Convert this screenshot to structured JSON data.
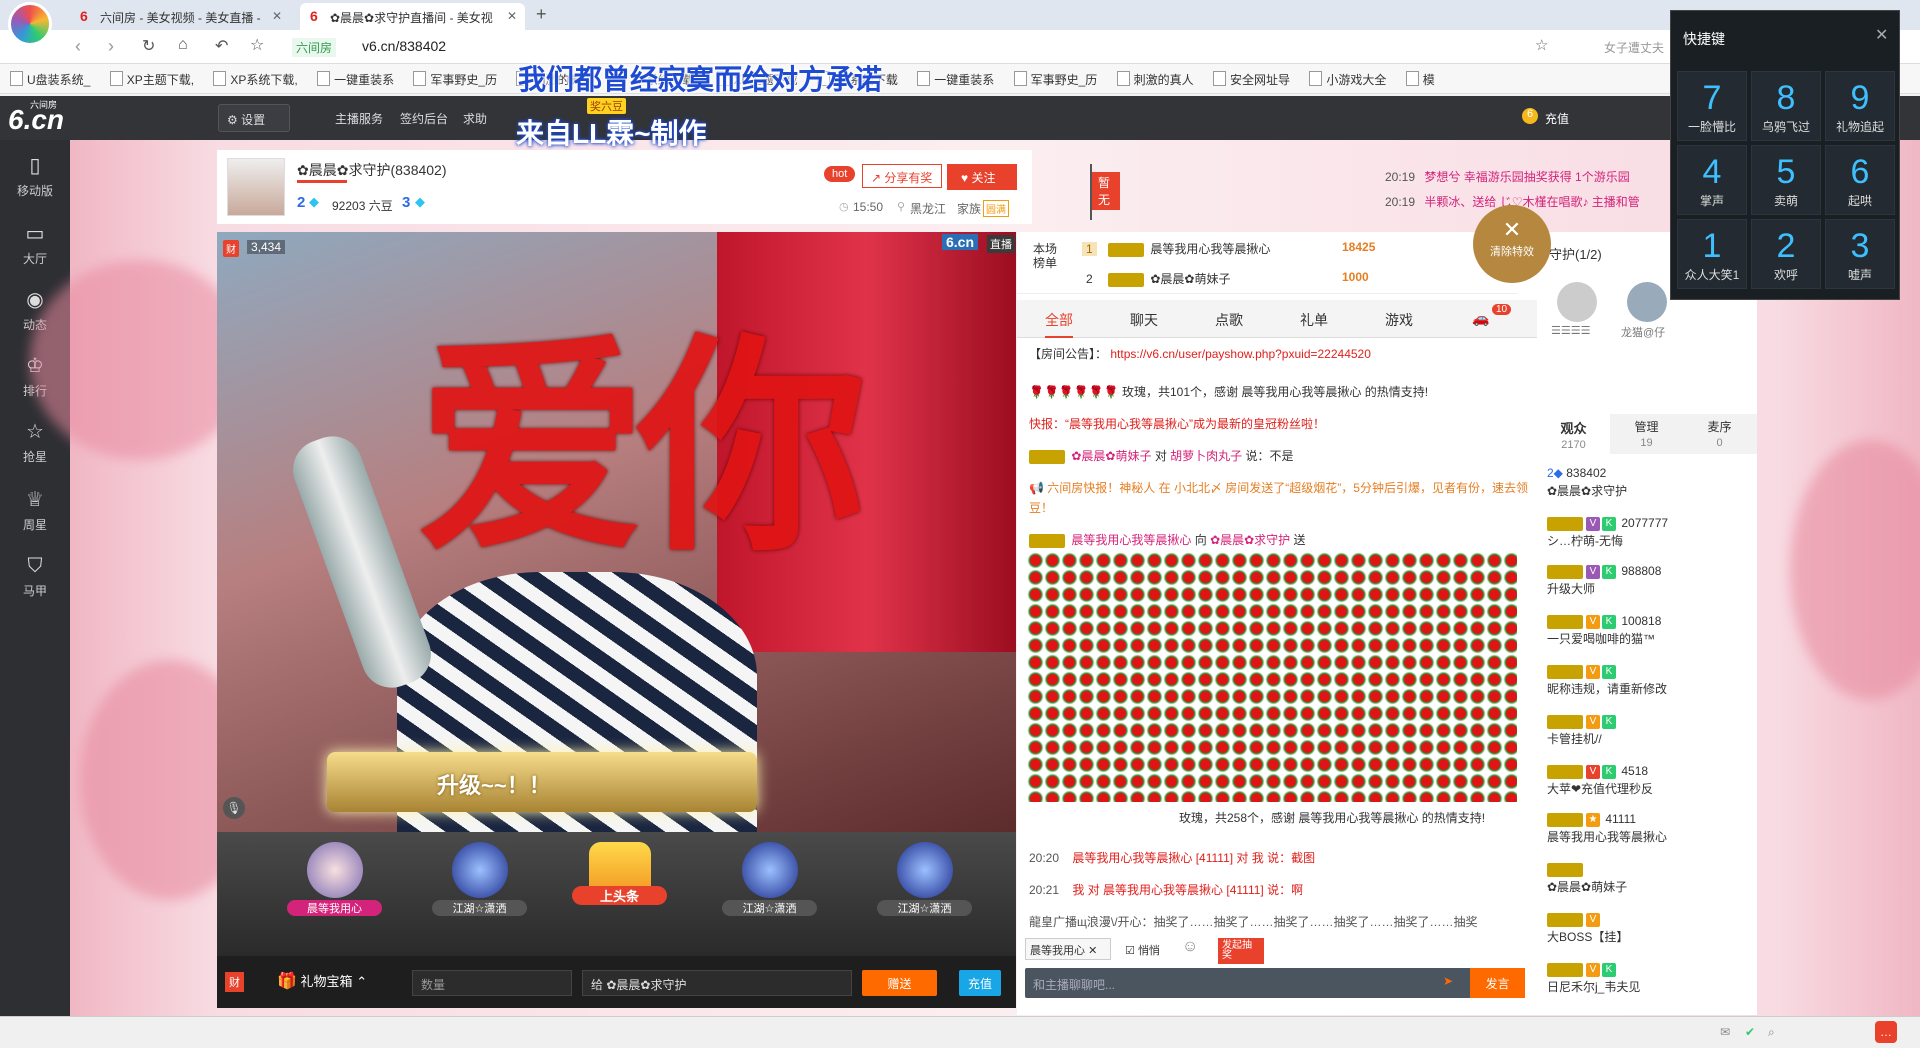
{
  "browser": {
    "tabs": [
      {
        "label": "六间房 - 美女视频 - 美女直播 -",
        "active": false
      },
      {
        "label": "✿晨晨✿求守护直播间 - 美女视",
        "active": true
      }
    ],
    "url_prefix": "六间房",
    "url": "v6.cn/838402",
    "search_placeholder": "女子遭丈夫..."
  },
  "bookmarks": [
    "U盘装系统_",
    "XP主题下载,",
    "XP系统下载,",
    "一键重装系",
    "军事野史_历",
    "刺激的真人",
    "XP系统下载.",
    "XP主题下载",
    "XP系统下载",
    "一键重装系",
    "军事野史_历",
    "刺激的真人",
    "安全网址导",
    "小游戏大全",
    "模"
  ],
  "overlay_texts": {
    "line1": "我们都曾经寂寞而给对方承诺",
    "line2": "来自LL霖~制作"
  },
  "site": {
    "logo": "6.cn",
    "logo_sub": "六间房",
    "settings": "设置",
    "nav": [
      "主播服务",
      "签约后台",
      "求助"
    ],
    "recharge": "充值",
    "gift_tag": "奖六豆"
  },
  "sidebar": [
    "移动版",
    "大厅",
    "动态",
    "排行",
    "抢星",
    "周星",
    "马甲"
  ],
  "anchor": {
    "name": "✿晨晨✿求守护(838402)",
    "level_num": "2",
    "beans": "92203 六豆",
    "rank_num": "3",
    "hot": "hot",
    "share": "分享有奖",
    "follow": "关注",
    "time": "15:50",
    "location": "黑龙江",
    "family": "家族",
    "family_tag": "圆满",
    "flag": "暂无"
  },
  "video": {
    "viewer_count": "3,434",
    "wealth_tag": "财",
    "brand": "6.cn",
    "live": "直播",
    "upgrade_text": "升级~~！！",
    "effect_text": "爱你"
  },
  "gift_bar": {
    "items": [
      "晨等我用心",
      "江湖☆潇洒",
      "上头条",
      "江湖☆潇洒",
      "江湖☆潇洒"
    ],
    "treasure": "礼物宝箱",
    "qty_placeholder": "数量",
    "to": "给",
    "to_name": "✿晨晨✿求守护",
    "send": "赠送",
    "recharge": "充值",
    "cai": "财"
  },
  "rank": {
    "label": "本场榜单",
    "rows": [
      {
        "pos": "1",
        "name": "晨等我用心我等晨揪心",
        "value": "18425"
      },
      {
        "pos": "2",
        "name": "✿晨晨✿萌妹子",
        "value": "1000"
      }
    ]
  },
  "clear_effects": "清除特效",
  "chat": {
    "tabs": [
      "全部",
      "聊天",
      "点歌",
      "礼单",
      "游戏"
    ],
    "tab_badge": "10",
    "announcement_label": "【房间公告】：",
    "announcement_url": "https://v6.cn/user/payshow.php?pxuid=22244520",
    "msg1": "玫瑰，共101个，感谢 晨等我用心我等晨揪心 的热情支持!",
    "msg2": "快报：“晨等我用心我等晨揪心”成为最新的皇冠粉丝啦！",
    "msg3_user": "✿晨晨✿萌妹子",
    "msg3_to": "胡萝卜肉丸子",
    "msg3_text": "说：不是",
    "msg4": "六间房快报！神秘人 在 小北北〆 房间发送了“超级烟花”，5分钟后引爆，见者有份，速去领豆！",
    "msg5_user": "晨等我用心我等晨揪心",
    "msg5_to": "✿晨晨✿求守护",
    "msg5_verb": "送",
    "msg6": "玫瑰，共258个，感谢 晨等我用心我等晨揪心 的热情支持!",
    "msg7_time": "20:20",
    "msg7_text": "晨等我用心我等晨揪心 [41111] 对 我 说：截图",
    "msg8_time": "20:21",
    "msg8_text": "我 对 晨等我用心我等晨揪心 [41111] 说：啊",
    "broadcast": "龍皇广播щ浪漫\\/开心：抽奖了……抽奖了……抽奖了……抽奖了……抽奖了……抽奖",
    "top_notices": [
      {
        "time": "20:19",
        "text": "梦想兮 幸福游乐园抽奖获得 1个游乐园"
      },
      {
        "time": "20:19",
        "text": "半颗冰、送给 じ♡木槿在唱歌♪ 主播和管"
      }
    ],
    "target_user": "晨等我用心",
    "whisper": "悄悄",
    "input_placeholder": "和主播聊聊吧...",
    "send": "发言",
    "prize_tag": "发起抽奖"
  },
  "right": {
    "guard_title": "守护(1/2)",
    "guard_names": [
      "☰☰☰☰",
      "龙猫@仔"
    ],
    "tabs": [
      {
        "label": "观众",
        "count": "2170"
      },
      {
        "label": "管理",
        "count": "19"
      },
      {
        "label": "麦序",
        "count": "0"
      }
    ],
    "users": [
      {
        "id": "838402",
        "name": "✿晨晨✿求守护"
      },
      {
        "id": "2077777",
        "name": "シ…柠萌-无悔"
      },
      {
        "id": "988808",
        "name": "升级大师"
      },
      {
        "id": "100818",
        "name": "一只爱喝咖啡的猫™"
      },
      {
        "id": "",
        "name": "昵称违规，请重新修改"
      },
      {
        "id": "",
        "name": "卡管挂机//"
      },
      {
        "id": "4518",
        "name": "大苹❤充值代理秒反"
      },
      {
        "id": "41111",
        "name": "晨等我用心我等晨揪心"
      },
      {
        "id": "",
        "name": "✿晨晨✿萌妹子"
      },
      {
        "id": "",
        "name": "大BOSS【挂】"
      },
      {
        "id": "",
        "name": "日尼禾尔j_韦夫见"
      }
    ]
  },
  "shortcut": {
    "title": "快捷键",
    "keys": [
      {
        "n": "7",
        "l": "一脸懵比"
      },
      {
        "n": "8",
        "l": "乌鸦飞过"
      },
      {
        "n": "9",
        "l": "礼物追起"
      },
      {
        "n": "4",
        "l": "掌声"
      },
      {
        "n": "5",
        "l": "卖萌"
      },
      {
        "n": "6",
        "l": "起哄"
      },
      {
        "n": "1",
        "l": "众人大笑1"
      },
      {
        "n": "2",
        "l": "欢呼"
      },
      {
        "n": "3",
        "l": "嘘声"
      }
    ]
  },
  "colors": {
    "brand_red": "#e8412c",
    "send_orange": "#ff6a00",
    "recharge_blue": "#19a6e6",
    "accent_teal": "#3ec0ff"
  }
}
